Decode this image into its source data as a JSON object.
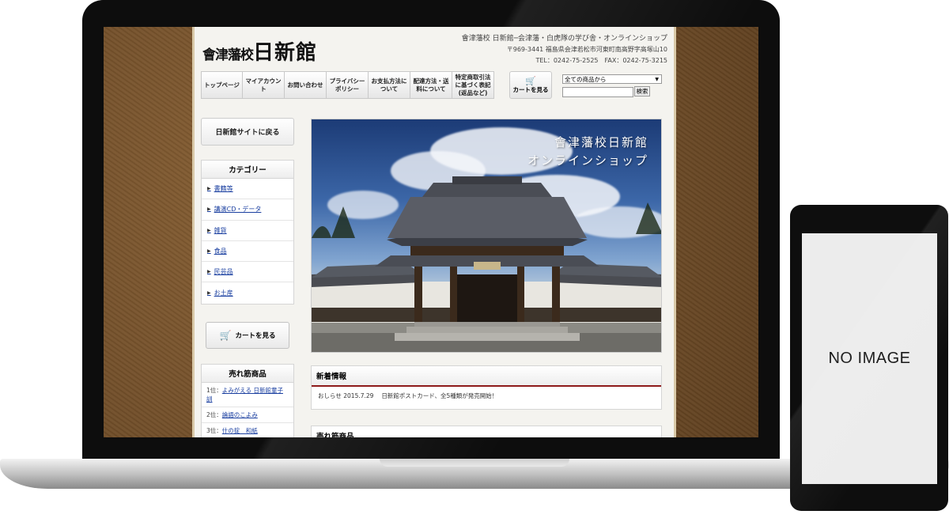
{
  "site": {
    "logo_small": "會津藩校",
    "logo_big": "日新館",
    "tagline": "會津藩校 日新館─会津藩・白虎隊の学び舎・オンラインショップ",
    "address": "〒969-3441 福島県会津若松市河東町南高野字高塚山10",
    "contact": "TEL：0242-75-2525　FAX：0242-75-3215"
  },
  "nav": {
    "items": [
      {
        "label": "トップページ"
      },
      {
        "label": "マイアカウント"
      },
      {
        "label": "お問い合わせ"
      },
      {
        "label": "プライバシーポリシー"
      },
      {
        "label": "お支払方法について"
      },
      {
        "label": "配達方法・送料について"
      },
      {
        "label": "特定商取引法に基づく表記(返品など)"
      }
    ],
    "cart_label": "カートを見る"
  },
  "search": {
    "select_value": "全ての商品から",
    "button_label": "検索",
    "input_value": ""
  },
  "sidebar": {
    "back_label": "日新館サイトに戻る",
    "category_title": "カテゴリー",
    "categories": [
      {
        "label": "書籍等"
      },
      {
        "label": "講演CD・データ"
      },
      {
        "label": "雑貨"
      },
      {
        "label": "食品"
      },
      {
        "label": "民芸品"
      },
      {
        "label": "お土産"
      }
    ],
    "cart_label": "カートを見る",
    "ranking_title": "売れ筋商品",
    "ranking": [
      {
        "rank": "1位：",
        "name": "よみがえる 日新館童子訓"
      },
      {
        "rank": "2位：",
        "name": "論語のこよみ"
      },
      {
        "rank": "3位：",
        "name": "什の掟　和紙"
      }
    ]
  },
  "hero": {
    "title_line1": "會津藩校日新館",
    "title_line2": "オンラインショップ"
  },
  "news": {
    "title": "新着情報",
    "items": [
      {
        "label": "おしらせ",
        "date": "2015.7.29",
        "text": "日新館ポストカード、全5種類が発売開始！"
      }
    ]
  },
  "bestsellers": {
    "title": "売れ筋商品"
  },
  "phone": {
    "placeholder": "NO IMAGE"
  },
  "colors": {
    "accent_red": "#8e1b1b",
    "link_blue": "#1a3fa0",
    "wood_brown": "#7a5530"
  }
}
